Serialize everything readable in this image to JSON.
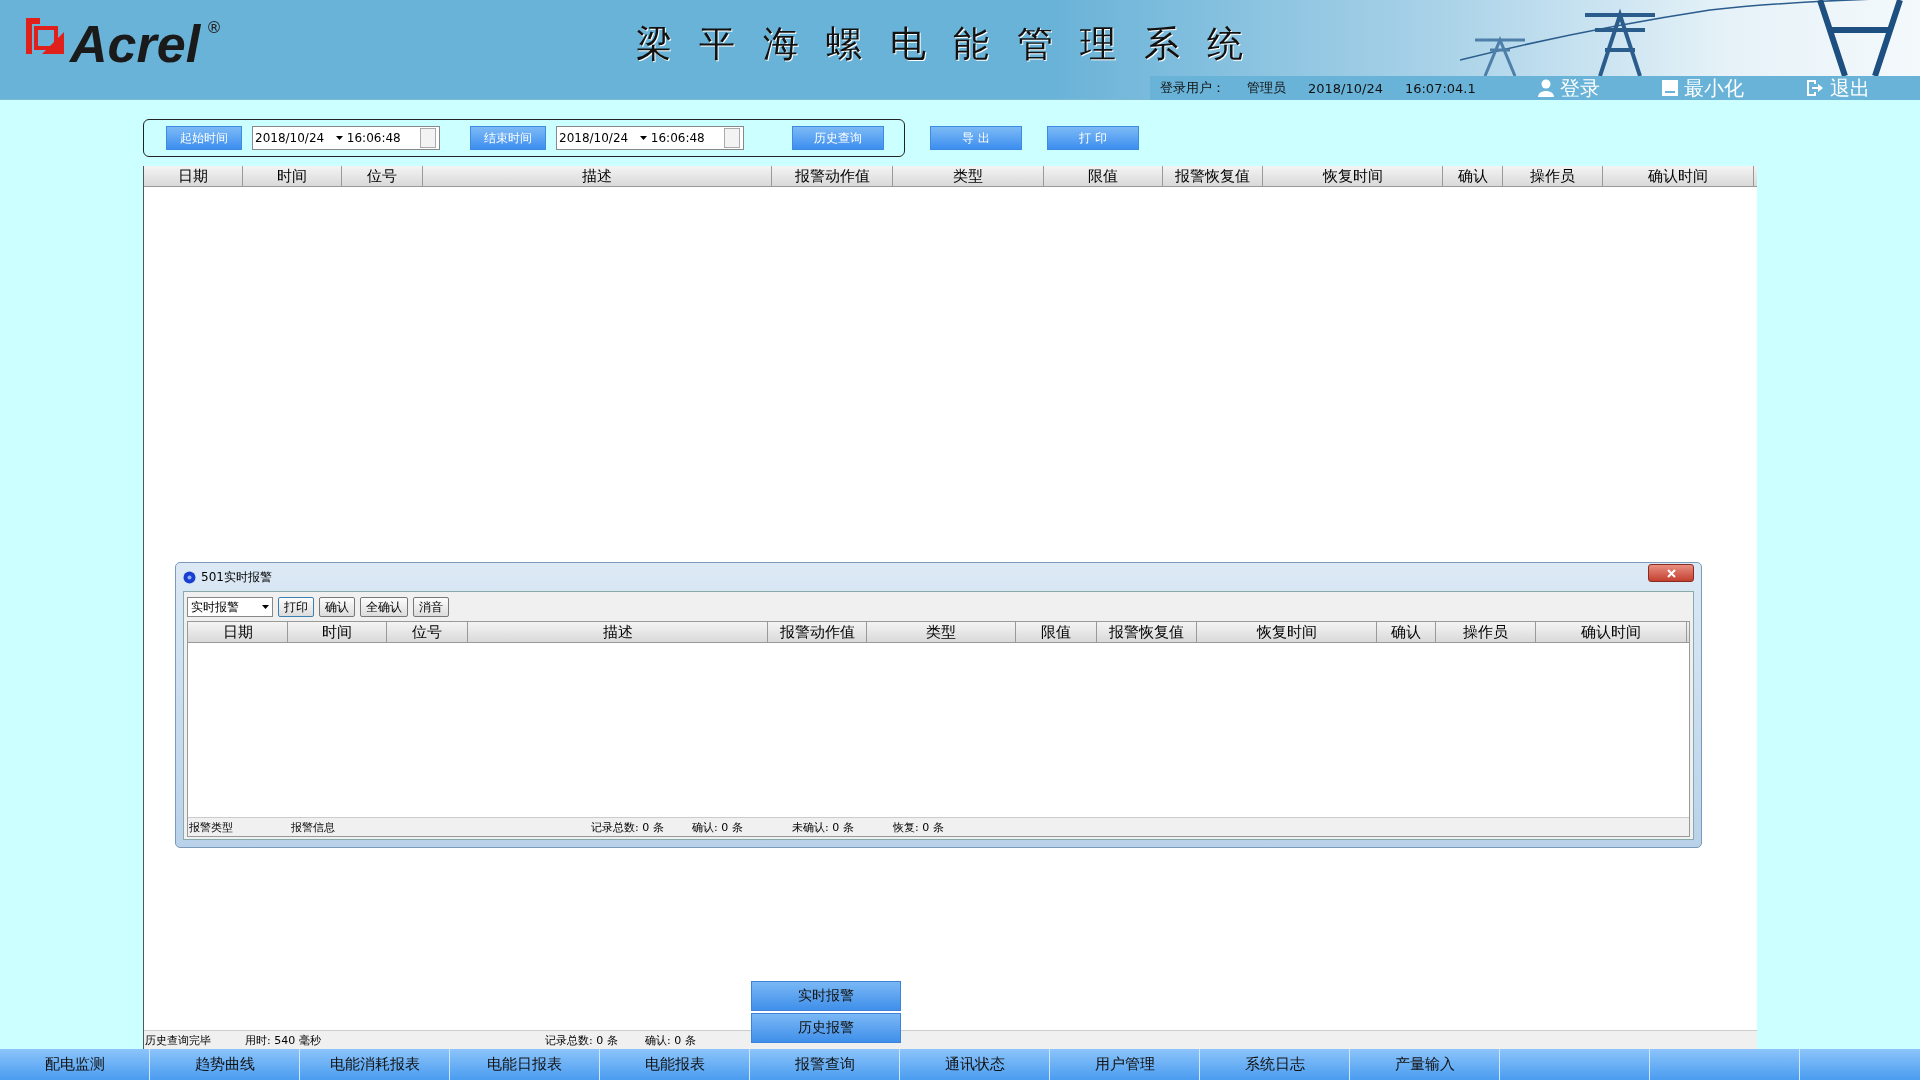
{
  "header": {
    "logo": "Acrel",
    "registered": "®",
    "title": "梁 平 海 螺 电 能 管 理 系 统",
    "user_label": "登录用户：",
    "user": "管理员",
    "date": "2018/10/24",
    "time": "16:07:04.1",
    "actions": [
      {
        "kind": "login",
        "label": "登录"
      },
      {
        "kind": "minimize",
        "label": "最小化"
      },
      {
        "kind": "exit",
        "label": "退出"
      }
    ]
  },
  "query": {
    "start_button": "起始时间",
    "start_date": "2018/10/24",
    "start_time": "16:06:48",
    "end_button": "结束时间",
    "end_date": "2018/10/24",
    "end_time": "16:06:48",
    "query_button": "历史查询",
    "export_button": "导 出",
    "print_button": "打 印"
  },
  "table": {
    "columns": [
      "日期",
      "时间",
      "位号",
      "描述",
      "报警动作值",
      "类型",
      "限值",
      "报警恢复值",
      "恢复时间",
      "确认",
      "操作员",
      "确认时间"
    ]
  },
  "status_bar": [
    "历史查询完毕",
    "用时: 540 毫秒",
    "记录总数: 0 条",
    "确认: 0 条"
  ],
  "dialog": {
    "title": "501实时报警",
    "filter": "实时报警",
    "buttons": [
      "打印",
      "确认",
      "全确认",
      "消音"
    ],
    "columns": [
      "日期",
      "时间",
      "位号",
      "描述",
      "报警动作值",
      "类型",
      "限值",
      "报警恢复值",
      "恢复时间",
      "确认",
      "操作员",
      "确认时间"
    ],
    "status": [
      "报警类型",
      "报警信息",
      "记录总数: 0 条",
      "确认: 0 条",
      "未确认: 0 条",
      "恢复: 0 条"
    ]
  },
  "popup_menu": [
    {
      "label": "实时报警"
    },
    {
      "label": "历史报警"
    }
  ],
  "nav": [
    {
      "label": "配电监测"
    },
    {
      "label": "趋势曲线"
    },
    {
      "label": "电能消耗报表"
    },
    {
      "label": "电能日报表"
    },
    {
      "label": "电能报表"
    },
    {
      "label": "报警查询"
    },
    {
      "label": "通讯状态"
    },
    {
      "label": "用户管理"
    },
    {
      "label": "系统日志"
    },
    {
      "label": "产量输入"
    }
  ]
}
